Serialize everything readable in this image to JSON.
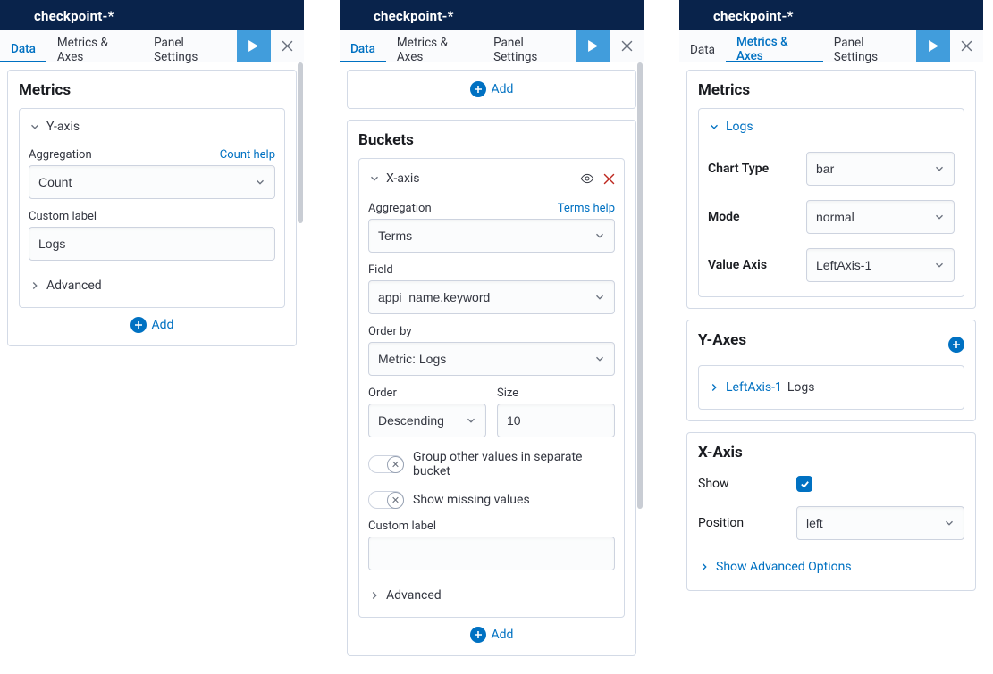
{
  "header": {
    "title": "checkpoint-*"
  },
  "tabs": {
    "data": "Data",
    "metrics_axes": "Metrics & Axes",
    "panel_settings": "Panel Settings"
  },
  "actions": {
    "add": "Add"
  },
  "panel1": {
    "metrics_title": "Metrics",
    "yaxis_label": "Y-axis",
    "aggregation_label": "Aggregation",
    "aggregation_help": "Count help",
    "aggregation_value": "Count",
    "custom_label_label": "Custom label",
    "custom_label_value": "Logs",
    "advanced": "Advanced"
  },
  "panel2": {
    "buckets_title": "Buckets",
    "xaxis_label": "X-axis",
    "aggregation_label": "Aggregation",
    "aggregation_help": "Terms help",
    "aggregation_value": "Terms",
    "field_label": "Field",
    "field_value": "appi_name.keyword",
    "orderby_label": "Order by",
    "orderby_value": "Metric: Logs",
    "order_label": "Order",
    "order_value": "Descending",
    "size_label": "Size",
    "size_value": "10",
    "group_other": "Group other values in separate bucket",
    "show_missing": "Show missing values",
    "custom_label_label": "Custom label",
    "custom_label_value": "",
    "advanced": "Advanced"
  },
  "panel3": {
    "metrics_title": "Metrics",
    "logs_label": "Logs",
    "chart_type_label": "Chart Type",
    "chart_type_value": "bar",
    "mode_label": "Mode",
    "mode_value": "normal",
    "value_axis_label": "Value Axis",
    "value_axis_value": "LeftAxis-1",
    "yaxes_title": "Y-Axes",
    "leftaxis_link": "LeftAxis-1",
    "leftaxis_suffix": "Logs",
    "xaxis_title": "X-Axis",
    "show_label": "Show",
    "position_label": "Position",
    "position_value": "left",
    "show_advanced": "Show Advanced Options"
  }
}
